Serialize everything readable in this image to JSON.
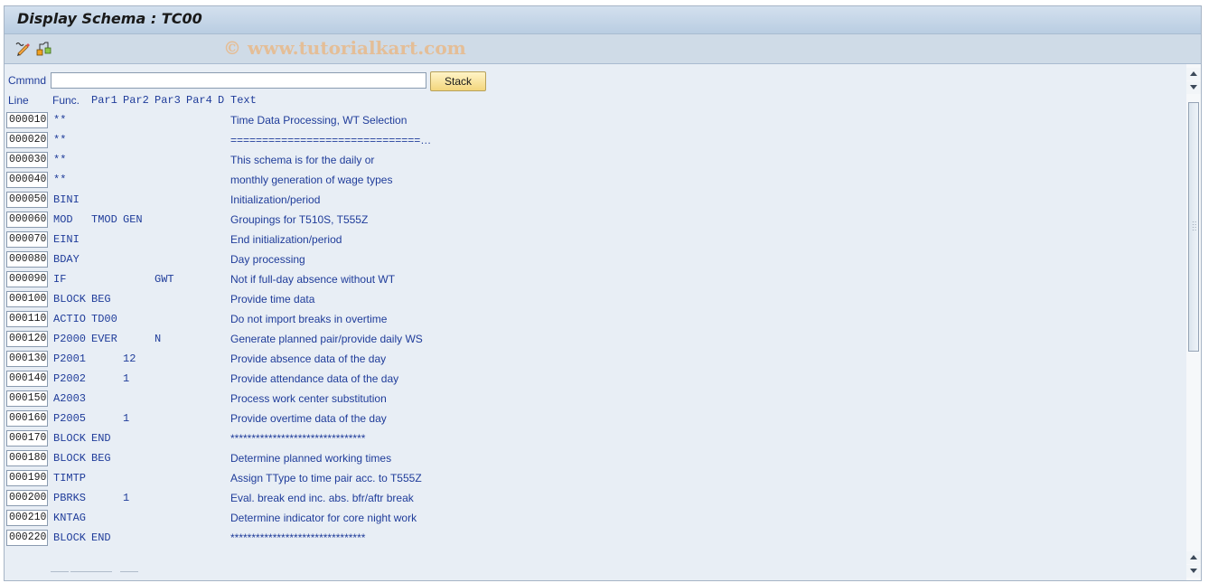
{
  "window": {
    "title": "Display Schema : TC00",
    "watermark": "© www.tutorialkart.com"
  },
  "toolbar": {
    "icons": [
      "display-change-icon",
      "hierarchy-icon"
    ]
  },
  "command": {
    "label": "Cmmnd",
    "value": "",
    "placeholder": "",
    "stack_button": "Stack"
  },
  "table": {
    "headers": {
      "line": "Line",
      "func": "Func.",
      "par1": "Par1",
      "par2": "Par2",
      "par3": "Par3",
      "par4": "Par4",
      "d": "D",
      "text": "Text"
    },
    "rows": [
      {
        "line": "000010",
        "func": "**",
        "par1": "",
        "par2": "",
        "par3": "",
        "par4": "",
        "d": "",
        "text": "Time Data Processing, WT Selection"
      },
      {
        "line": "000020",
        "func": "**",
        "par1": "",
        "par2": "",
        "par3": "",
        "par4": "",
        "d": "",
        "text": "==============================…"
      },
      {
        "line": "000030",
        "func": "**",
        "par1": "",
        "par2": "",
        "par3": "",
        "par4": "",
        "d": "",
        "text": "This schema is for the daily or"
      },
      {
        "line": "000040",
        "func": "**",
        "par1": "",
        "par2": "",
        "par3": "",
        "par4": "",
        "d": "",
        "text": "monthly generation of wage types"
      },
      {
        "line": "000050",
        "func": "BINI",
        "par1": "",
        "par2": "",
        "par3": "",
        "par4": "",
        "d": "",
        "text": "Initialization/period"
      },
      {
        "line": "000060",
        "func": "MOD",
        "par1": "TMOD",
        "par2": "GEN",
        "par3": "",
        "par4": "",
        "d": "",
        "text": "Groupings for T510S, T555Z"
      },
      {
        "line": "000070",
        "func": "EINI",
        "par1": "",
        "par2": "",
        "par3": "",
        "par4": "",
        "d": "",
        "text": "End initialization/period"
      },
      {
        "line": "000080",
        "func": "BDAY",
        "par1": "",
        "par2": "",
        "par3": "",
        "par4": "",
        "d": "",
        "text": "Day processing"
      },
      {
        "line": "000090",
        "func": "IF",
        "par1": "",
        "par2": "",
        "par3": "GWT",
        "par4": "",
        "d": "",
        "text": "Not if full-day absence without WT"
      },
      {
        "line": "000100",
        "func": "BLOCK",
        "par1": "BEG",
        "par2": "",
        "par3": "",
        "par4": "",
        "d": "",
        "text": "Provide time data"
      },
      {
        "line": "000110",
        "func": "ACTIO",
        "par1": "TD00",
        "par2": "",
        "par3": "",
        "par4": "",
        "d": "",
        "text": "Do not import breaks in overtime"
      },
      {
        "line": "000120",
        "func": "P2000",
        "par1": "EVER",
        "par2": "",
        "par3": "N",
        "par4": "",
        "d": "",
        "text": "Generate planned pair/provide daily WS"
      },
      {
        "line": "000130",
        "func": "P2001",
        "par1": "",
        "par2": "12",
        "par3": "",
        "par4": "",
        "d": "",
        "text": "Provide absence data of the day"
      },
      {
        "line": "000140",
        "func": "P2002",
        "par1": "",
        "par2": "1",
        "par3": "",
        "par4": "",
        "d": "",
        "text": "Provide attendance data of the day"
      },
      {
        "line": "000150",
        "func": "A2003",
        "par1": "",
        "par2": "",
        "par3": "",
        "par4": "",
        "d": "",
        "text": "Process work center substitution"
      },
      {
        "line": "000160",
        "func": "P2005",
        "par1": "",
        "par2": "1",
        "par3": "",
        "par4": "",
        "d": "",
        "text": "Provide overtime data of the day"
      },
      {
        "line": "000170",
        "func": "BLOCK",
        "par1": "END",
        "par2": "",
        "par3": "",
        "par4": "",
        "d": "",
        "text": "********************************"
      },
      {
        "line": "000180",
        "func": "BLOCK",
        "par1": "BEG",
        "par2": "",
        "par3": "",
        "par4": "",
        "d": "",
        "text": "Determine planned working times"
      },
      {
        "line": "000190",
        "func": "TIMTP",
        "par1": "",
        "par2": "",
        "par3": "",
        "par4": "",
        "d": "",
        "text": "Assign TType to time pair acc. to T555Z"
      },
      {
        "line": "000200",
        "func": "PBRKS",
        "par1": "",
        "par2": "1",
        "par3": "",
        "par4": "",
        "d": "",
        "text": "Eval. break end inc. abs. bfr/aftr break"
      },
      {
        "line": "000210",
        "func": "KNTAG",
        "par1": "",
        "par2": "",
        "par3": "",
        "par4": "",
        "d": "",
        "text": "Determine indicator for core night work"
      },
      {
        "line": "000220",
        "func": "BLOCK",
        "par1": "END",
        "par2": "",
        "par3": "",
        "par4": "",
        "d": "",
        "text": "********************************"
      }
    ]
  }
}
